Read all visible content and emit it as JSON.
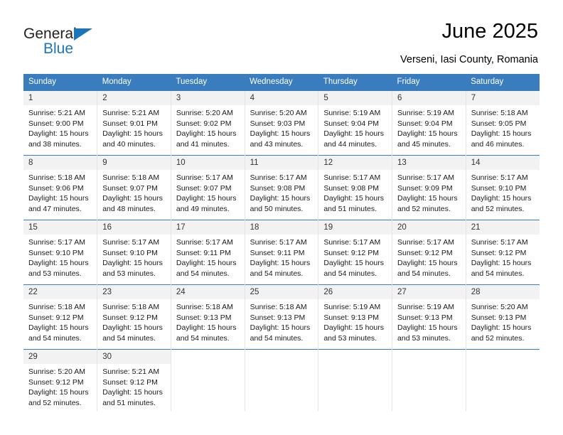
{
  "brand": {
    "name_part1": "General",
    "name_part2": "Blue",
    "triangle_color": "#1b75bb"
  },
  "header": {
    "title": "June 2025",
    "subtitle": "Verseni, Iasi County, Romania"
  },
  "theme": {
    "header_row_bg": "#3a7dbf",
    "header_row_text": "#ffffff",
    "daynum_bg": "#f2f2f2",
    "row_separator": "#3a7dbf",
    "column_separator": "#e3e3e3"
  },
  "weekday_headers": [
    "Sunday",
    "Monday",
    "Tuesday",
    "Wednesday",
    "Thursday",
    "Friday",
    "Saturday"
  ],
  "labels": {
    "sunrise_prefix": "Sunrise:",
    "sunset_prefix": "Sunset:",
    "daylight_prefix": "Daylight:"
  },
  "weeks": [
    [
      {
        "day": "1",
        "sunrise": "Sunrise: 5:21 AM",
        "sunset": "Sunset: 9:00 PM",
        "daylight1": "Daylight: 15 hours",
        "daylight2": "and 38 minutes."
      },
      {
        "day": "2",
        "sunrise": "Sunrise: 5:21 AM",
        "sunset": "Sunset: 9:01 PM",
        "daylight1": "Daylight: 15 hours",
        "daylight2": "and 40 minutes."
      },
      {
        "day": "3",
        "sunrise": "Sunrise: 5:20 AM",
        "sunset": "Sunset: 9:02 PM",
        "daylight1": "Daylight: 15 hours",
        "daylight2": "and 41 minutes."
      },
      {
        "day": "4",
        "sunrise": "Sunrise: 5:20 AM",
        "sunset": "Sunset: 9:03 PM",
        "daylight1": "Daylight: 15 hours",
        "daylight2": "and 43 minutes."
      },
      {
        "day": "5",
        "sunrise": "Sunrise: 5:19 AM",
        "sunset": "Sunset: 9:04 PM",
        "daylight1": "Daylight: 15 hours",
        "daylight2": "and 44 minutes."
      },
      {
        "day": "6",
        "sunrise": "Sunrise: 5:19 AM",
        "sunset": "Sunset: 9:04 PM",
        "daylight1": "Daylight: 15 hours",
        "daylight2": "and 45 minutes."
      },
      {
        "day": "7",
        "sunrise": "Sunrise: 5:18 AM",
        "sunset": "Sunset: 9:05 PM",
        "daylight1": "Daylight: 15 hours",
        "daylight2": "and 46 minutes."
      }
    ],
    [
      {
        "day": "8",
        "sunrise": "Sunrise: 5:18 AM",
        "sunset": "Sunset: 9:06 PM",
        "daylight1": "Daylight: 15 hours",
        "daylight2": "and 47 minutes."
      },
      {
        "day": "9",
        "sunrise": "Sunrise: 5:18 AM",
        "sunset": "Sunset: 9:07 PM",
        "daylight1": "Daylight: 15 hours",
        "daylight2": "and 48 minutes."
      },
      {
        "day": "10",
        "sunrise": "Sunrise: 5:17 AM",
        "sunset": "Sunset: 9:07 PM",
        "daylight1": "Daylight: 15 hours",
        "daylight2": "and 49 minutes."
      },
      {
        "day": "11",
        "sunrise": "Sunrise: 5:17 AM",
        "sunset": "Sunset: 9:08 PM",
        "daylight1": "Daylight: 15 hours",
        "daylight2": "and 50 minutes."
      },
      {
        "day": "12",
        "sunrise": "Sunrise: 5:17 AM",
        "sunset": "Sunset: 9:08 PM",
        "daylight1": "Daylight: 15 hours",
        "daylight2": "and 51 minutes."
      },
      {
        "day": "13",
        "sunrise": "Sunrise: 5:17 AM",
        "sunset": "Sunset: 9:09 PM",
        "daylight1": "Daylight: 15 hours",
        "daylight2": "and 52 minutes."
      },
      {
        "day": "14",
        "sunrise": "Sunrise: 5:17 AM",
        "sunset": "Sunset: 9:10 PM",
        "daylight1": "Daylight: 15 hours",
        "daylight2": "and 52 minutes."
      }
    ],
    [
      {
        "day": "15",
        "sunrise": "Sunrise: 5:17 AM",
        "sunset": "Sunset: 9:10 PM",
        "daylight1": "Daylight: 15 hours",
        "daylight2": "and 53 minutes."
      },
      {
        "day": "16",
        "sunrise": "Sunrise: 5:17 AM",
        "sunset": "Sunset: 9:10 PM",
        "daylight1": "Daylight: 15 hours",
        "daylight2": "and 53 minutes."
      },
      {
        "day": "17",
        "sunrise": "Sunrise: 5:17 AM",
        "sunset": "Sunset: 9:11 PM",
        "daylight1": "Daylight: 15 hours",
        "daylight2": "and 54 minutes."
      },
      {
        "day": "18",
        "sunrise": "Sunrise: 5:17 AM",
        "sunset": "Sunset: 9:11 PM",
        "daylight1": "Daylight: 15 hours",
        "daylight2": "and 54 minutes."
      },
      {
        "day": "19",
        "sunrise": "Sunrise: 5:17 AM",
        "sunset": "Sunset: 9:12 PM",
        "daylight1": "Daylight: 15 hours",
        "daylight2": "and 54 minutes."
      },
      {
        "day": "20",
        "sunrise": "Sunrise: 5:17 AM",
        "sunset": "Sunset: 9:12 PM",
        "daylight1": "Daylight: 15 hours",
        "daylight2": "and 54 minutes."
      },
      {
        "day": "21",
        "sunrise": "Sunrise: 5:17 AM",
        "sunset": "Sunset: 9:12 PM",
        "daylight1": "Daylight: 15 hours",
        "daylight2": "and 54 minutes."
      }
    ],
    [
      {
        "day": "22",
        "sunrise": "Sunrise: 5:18 AM",
        "sunset": "Sunset: 9:12 PM",
        "daylight1": "Daylight: 15 hours",
        "daylight2": "and 54 minutes."
      },
      {
        "day": "23",
        "sunrise": "Sunrise: 5:18 AM",
        "sunset": "Sunset: 9:12 PM",
        "daylight1": "Daylight: 15 hours",
        "daylight2": "and 54 minutes."
      },
      {
        "day": "24",
        "sunrise": "Sunrise: 5:18 AM",
        "sunset": "Sunset: 9:13 PM",
        "daylight1": "Daylight: 15 hours",
        "daylight2": "and 54 minutes."
      },
      {
        "day": "25",
        "sunrise": "Sunrise: 5:18 AM",
        "sunset": "Sunset: 9:13 PM",
        "daylight1": "Daylight: 15 hours",
        "daylight2": "and 54 minutes."
      },
      {
        "day": "26",
        "sunrise": "Sunrise: 5:19 AM",
        "sunset": "Sunset: 9:13 PM",
        "daylight1": "Daylight: 15 hours",
        "daylight2": "and 53 minutes."
      },
      {
        "day": "27",
        "sunrise": "Sunrise: 5:19 AM",
        "sunset": "Sunset: 9:13 PM",
        "daylight1": "Daylight: 15 hours",
        "daylight2": "and 53 minutes."
      },
      {
        "day": "28",
        "sunrise": "Sunrise: 5:20 AM",
        "sunset": "Sunset: 9:13 PM",
        "daylight1": "Daylight: 15 hours",
        "daylight2": "and 52 minutes."
      }
    ],
    [
      {
        "day": "29",
        "sunrise": "Sunrise: 5:20 AM",
        "sunset": "Sunset: 9:12 PM",
        "daylight1": "Daylight: 15 hours",
        "daylight2": "and 52 minutes."
      },
      {
        "day": "30",
        "sunrise": "Sunrise: 5:21 AM",
        "sunset": "Sunset: 9:12 PM",
        "daylight1": "Daylight: 15 hours",
        "daylight2": "and 51 minutes."
      },
      {
        "day": "",
        "sunrise": "",
        "sunset": "",
        "daylight1": "",
        "daylight2": ""
      },
      {
        "day": "",
        "sunrise": "",
        "sunset": "",
        "daylight1": "",
        "daylight2": ""
      },
      {
        "day": "",
        "sunrise": "",
        "sunset": "",
        "daylight1": "",
        "daylight2": ""
      },
      {
        "day": "",
        "sunrise": "",
        "sunset": "",
        "daylight1": "",
        "daylight2": ""
      },
      {
        "day": "",
        "sunrise": "",
        "sunset": "",
        "daylight1": "",
        "daylight2": ""
      }
    ]
  ]
}
